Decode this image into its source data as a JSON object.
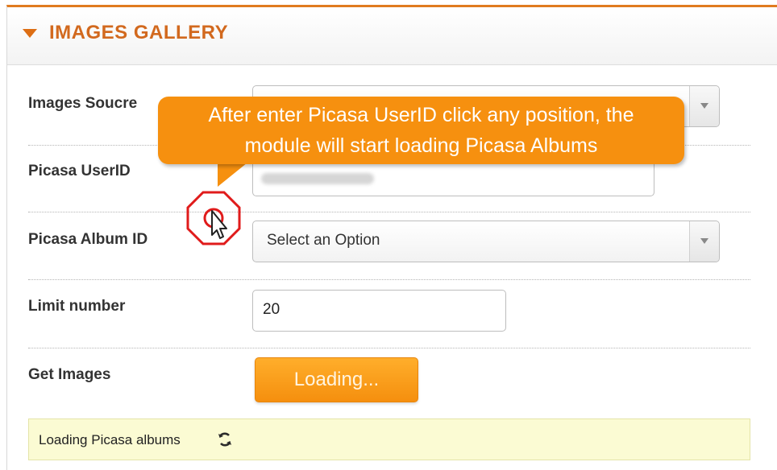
{
  "panel": {
    "title": "IMAGES GALLERY",
    "accent_color": "#e07b1f"
  },
  "fields": {
    "images_source": {
      "label": "Images Soucre",
      "value": ""
    },
    "picasa_userid": {
      "label": "Picasa UserID",
      "value": ""
    },
    "picasa_album_id": {
      "label": "Picasa Album ID",
      "value": "Select an Option"
    },
    "limit_number": {
      "label": "Limit number",
      "value": "20"
    },
    "get_images": {
      "label": "Get Images",
      "button_label": "Loading..."
    }
  },
  "status": {
    "text": "Loading Picasa albums",
    "icon": "refresh-icon",
    "background": "#fbfbd3"
  },
  "callout": {
    "line1": "After enter Picasa UserID  click any position, the",
    "line2": "module will start loading Picasa Albums",
    "color": "#f6900f"
  }
}
